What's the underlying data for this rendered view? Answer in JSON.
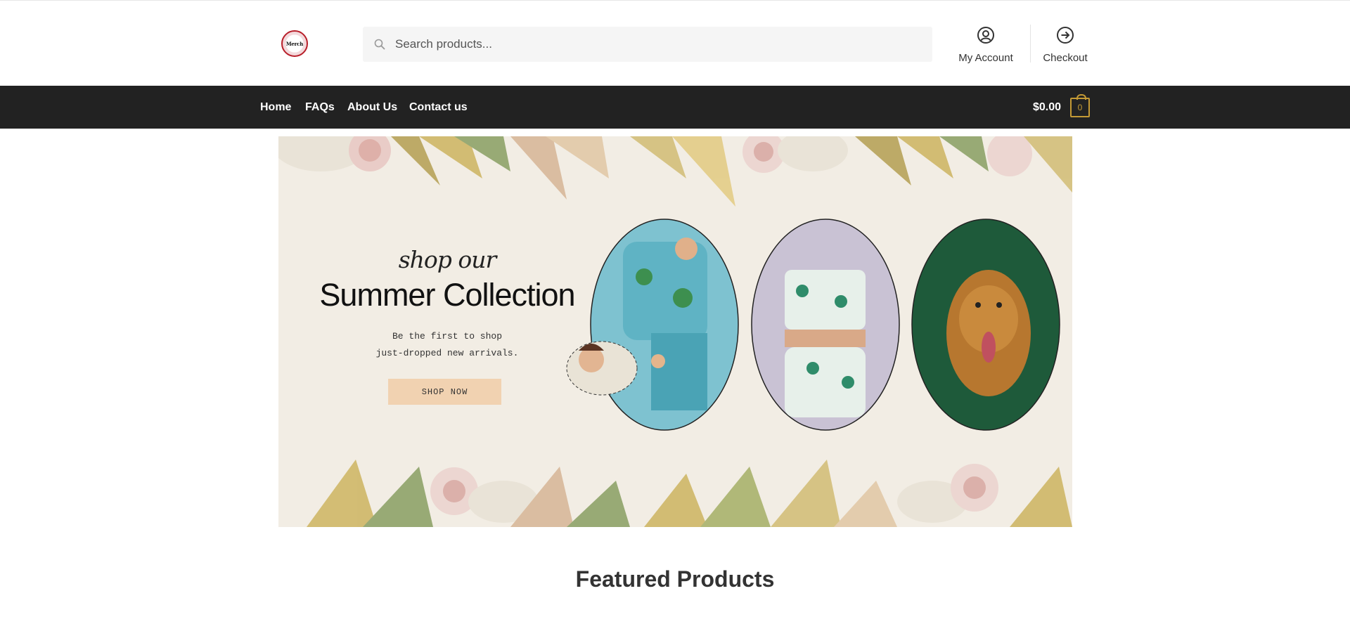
{
  "header": {
    "logo_text": "Merch",
    "search_placeholder": "Search products...",
    "account_label": "My Account",
    "checkout_label": "Checkout"
  },
  "nav": {
    "items": [
      "Home",
      "FAQs",
      "About Us",
      "Contact us"
    ],
    "cart_total": "$0.00",
    "cart_count": "0"
  },
  "hero": {
    "script_text": "shop our",
    "title": "Summer Collection",
    "tagline_line1": "Be the first to shop",
    "tagline_line2": "just-dropped new arrivals.",
    "button": "SHOP NOW"
  },
  "featured_heading": "Featured Products",
  "colors": {
    "nav_bg": "#222222",
    "cart_accent": "#c49a35",
    "hero_bg": "#f2ede4",
    "button_bg": "#f1d2b1"
  }
}
